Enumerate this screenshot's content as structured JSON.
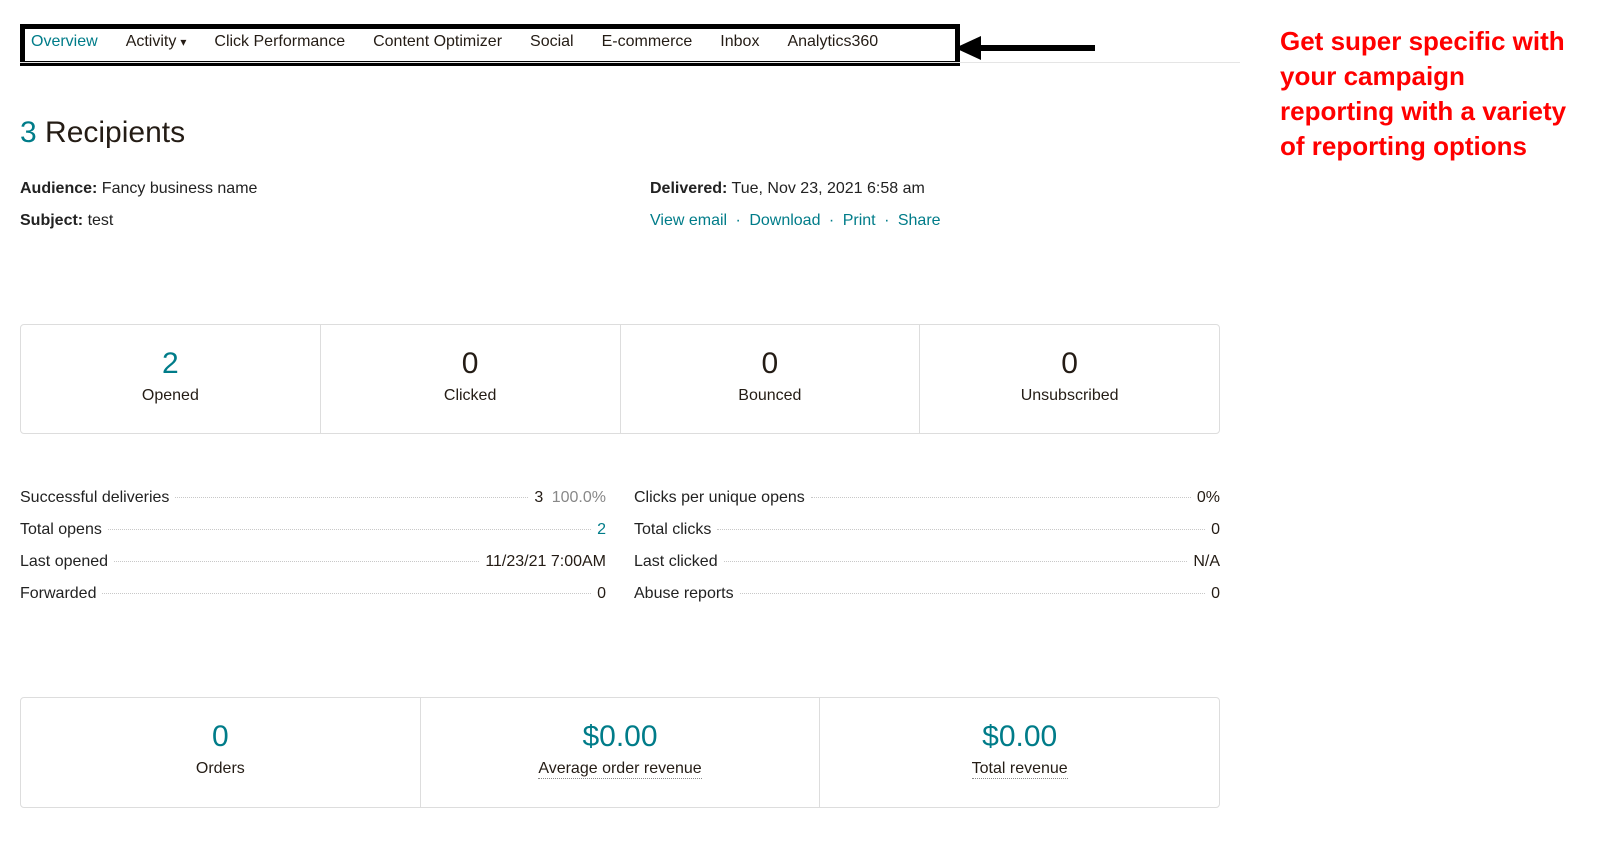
{
  "tabs": {
    "overview": "Overview",
    "activity": "Activity",
    "click_perf": "Click Performance",
    "content_opt": "Content Optimizer",
    "social": "Social",
    "ecommerce": "E-commerce",
    "inbox": "Inbox",
    "analytics360": "Analytics360"
  },
  "title": {
    "count": "3",
    "label": "Recipients"
  },
  "meta": {
    "audience_label": "Audience:",
    "audience_value": "Fancy business name",
    "subject_label": "Subject:",
    "subject_value": "test",
    "delivered_label": "Delivered:",
    "delivered_value": "Tue, Nov 23, 2021 6:58 am",
    "view_email": "View email",
    "download": "Download",
    "print": "Print",
    "share": "Share"
  },
  "cards": {
    "opened_val": "2",
    "opened_lab": "Opened",
    "clicked_val": "0",
    "clicked_lab": "Clicked",
    "bounced_val": "0",
    "bounced_lab": "Bounced",
    "unsub_val": "0",
    "unsub_lab": "Unsubscribed"
  },
  "stats_left": {
    "row1_lab": "Successful deliveries",
    "row1_val": "3",
    "row1_pct": "100.0%",
    "row2_lab": "Total opens",
    "row2_val": "2",
    "row3_lab": "Last opened",
    "row3_val": "11/23/21 7:00AM",
    "row4_lab": "Forwarded",
    "row4_val": "0"
  },
  "stats_right": {
    "row1_lab": "Clicks per unique opens",
    "row1_val": "0%",
    "row2_lab": "Total clicks",
    "row2_val": "0",
    "row3_lab": "Last clicked",
    "row3_val": "N/A",
    "row4_lab": "Abuse reports",
    "row4_val": "0"
  },
  "rev": {
    "orders_val": "0",
    "orders_lab": "Orders",
    "aor_val": "$0.00",
    "aor_lab": "Average order revenue",
    "total_val": "$0.00",
    "total_lab": "Total revenue"
  },
  "callout": "Get super specific with your campaign reporting with a variety of reporting options"
}
